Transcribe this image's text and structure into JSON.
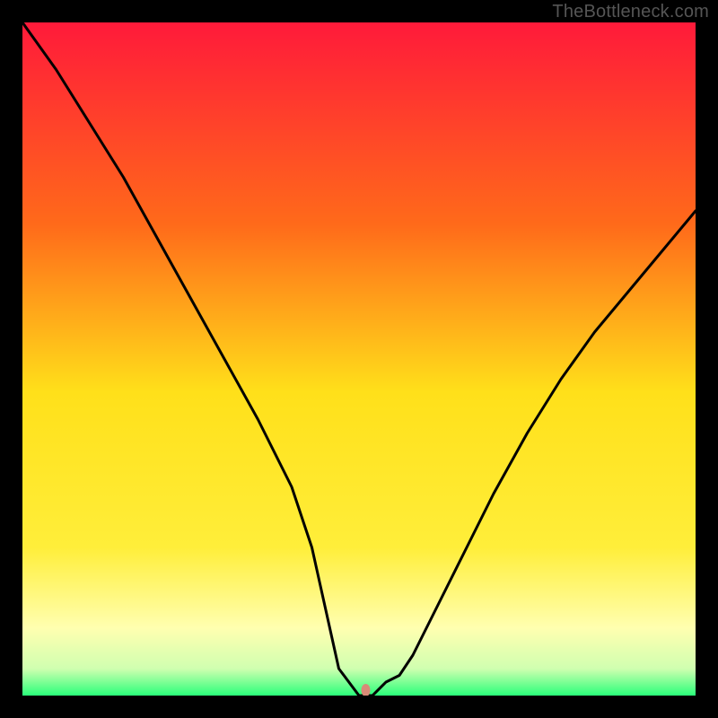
{
  "watermark": "TheBottleneck.com",
  "chart_data": {
    "type": "line",
    "title": "",
    "xlabel": "",
    "ylabel": "",
    "xlim": [
      0,
      100
    ],
    "ylim": [
      0,
      100
    ],
    "grid": false,
    "legend": false,
    "gradient_colors": {
      "top": "#ff1a3a",
      "mid_upper": "#ff8c1a",
      "mid": "#ffe01a",
      "mid_lower": "#ffff8a",
      "bottom": "#2aff7a"
    },
    "series": [
      {
        "name": "bottleneck-curve",
        "x": [
          0,
          5,
          10,
          15,
          20,
          25,
          30,
          35,
          40,
          43,
          45,
          47,
          50,
          52,
          54,
          56,
          58,
          62,
          66,
          70,
          75,
          80,
          85,
          90,
          95,
          100
        ],
        "y": [
          100,
          93,
          85,
          77,
          68,
          59,
          50,
          41,
          31,
          22,
          13,
          4,
          0,
          0,
          2,
          3,
          6,
          14,
          22,
          30,
          39,
          47,
          54,
          60,
          66,
          72
        ]
      }
    ],
    "marker": {
      "name": "optimal-point",
      "x": 51,
      "y": 0.8,
      "color": "#d98a77",
      "rx": 5,
      "ry": 7
    }
  }
}
